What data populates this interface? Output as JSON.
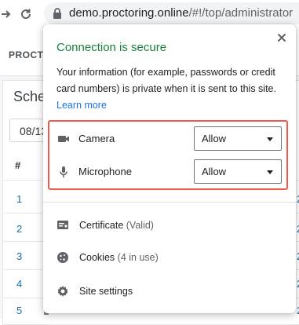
{
  "browser": {
    "url_host": "demo.proctoring.online",
    "url_rest": "/#!/top/administrator"
  },
  "page": {
    "brand": "PROCT",
    "card_title": "Schec",
    "date_value": "08/13",
    "columns": [
      "#",
      "T"
    ],
    "rows": [
      {
        "num": "1",
        "end": "2"
      },
      {
        "num": "2",
        "end": "2"
      },
      {
        "num": "3",
        "end": "2"
      },
      {
        "num": "4",
        "end": "2"
      },
      {
        "num": "5",
        "end": "2"
      }
    ]
  },
  "popup": {
    "title": "Connection is secure",
    "description": "Your information (for example, passwords or credit card numbers) is private when it is sent to this site.",
    "learn_more": "Learn more",
    "permissions": [
      {
        "icon": "camera-icon",
        "label": "Camera",
        "value": "Allow"
      },
      {
        "icon": "microphone-icon",
        "label": "Microphone",
        "value": "Allow"
      }
    ],
    "menu": {
      "certificate_label": "Certificate",
      "certificate_sub": "(Valid)",
      "cookies_label": "Cookies",
      "cookies_sub": "(4 in use)",
      "site_settings_label": "Site settings"
    }
  },
  "colors": {
    "secure_green": "#188038",
    "link_blue": "#1a73e8",
    "highlight_red": "#ef5b4a"
  }
}
